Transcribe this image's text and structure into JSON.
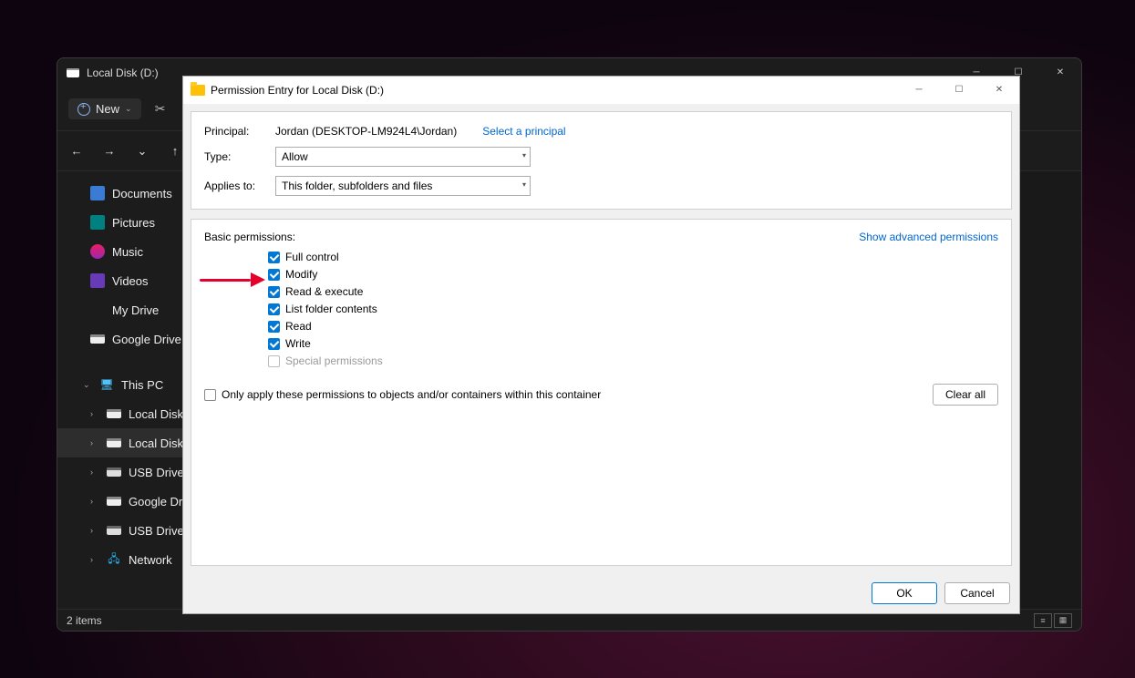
{
  "explorer": {
    "title": "Local Disk (D:)",
    "new_label": "New",
    "status": "2 items",
    "sidebar_quick": [
      {
        "icon": "blue",
        "label": "Documents",
        "pinned": true
      },
      {
        "icon": "teal",
        "label": "Pictures",
        "pinned": true
      },
      {
        "icon": "pink",
        "label": "Music",
        "pinned": true
      },
      {
        "icon": "purple",
        "label": "Videos",
        "pinned": true
      },
      {
        "icon": "folder",
        "label": "My Drive",
        "pinned": true
      },
      {
        "icon": "drive",
        "label": "Google Drive",
        "pinned": true
      }
    ],
    "thispc_label": "This PC",
    "drives": [
      {
        "icon": "drive",
        "label": "Local Disk (C:)"
      },
      {
        "icon": "drive",
        "label": "Local Disk (D:)",
        "selected": true
      },
      {
        "icon": "usb",
        "label": "USB Drive (E:)"
      },
      {
        "icon": "drive",
        "label": "Google Drive (G:)"
      },
      {
        "icon": "usb",
        "label": "USB Drive (E:)"
      }
    ],
    "network_label": "Network"
  },
  "dialog": {
    "title": "Permission Entry for Local Disk (D:)",
    "principal_label": "Principal:",
    "principal_value": "Jordan (DESKTOP-LM924L4\\Jordan)",
    "select_principal": "Select a principal",
    "type_label": "Type:",
    "type_value": "Allow",
    "applies_label": "Applies to:",
    "applies_value": "This folder, subfolders and files",
    "basic_label": "Basic permissions:",
    "advanced_link": "Show advanced permissions",
    "permissions": [
      {
        "label": "Full control",
        "checked": true,
        "disabled": false
      },
      {
        "label": "Modify",
        "checked": true,
        "disabled": false
      },
      {
        "label": "Read & execute",
        "checked": true,
        "disabled": false
      },
      {
        "label": "List folder contents",
        "checked": true,
        "disabled": false
      },
      {
        "label": "Read",
        "checked": true,
        "disabled": false
      },
      {
        "label": "Write",
        "checked": true,
        "disabled": false
      },
      {
        "label": "Special permissions",
        "checked": false,
        "disabled": true
      }
    ],
    "only_apply_label": "Only apply these permissions to objects and/or containers within this container",
    "clear_all": "Clear all",
    "ok": "OK",
    "cancel": "Cancel"
  }
}
